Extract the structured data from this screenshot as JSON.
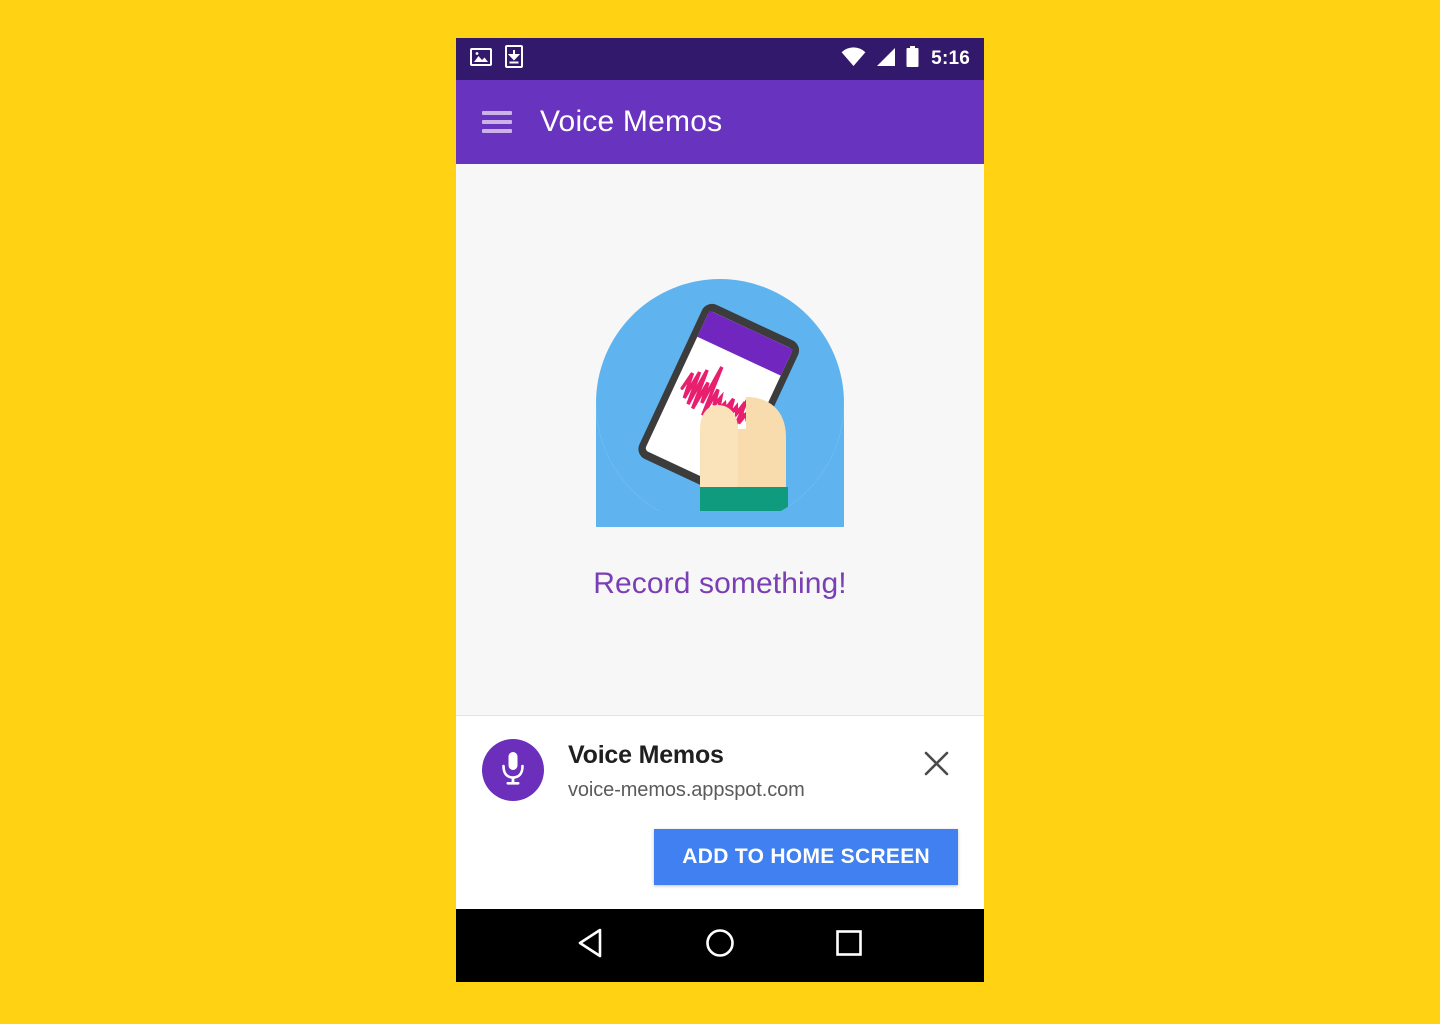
{
  "colors": {
    "page_background": "#FFD213",
    "status_bar": "#33196B",
    "app_bar": "#6833BE",
    "content_background": "#F7F7F7",
    "empty_text": "#7B3FB5",
    "cta_blue": "#4080F0",
    "badge_purple": "#6B2FBB",
    "illustration_circle": "#5FB4F0",
    "illustration_sleeve": "#0E9B7E",
    "illustration_skin": "#F8DCAE",
    "illustration_waveform": "#E81E6E",
    "nav_bar": "#000000"
  },
  "status_bar": {
    "left_icons": [
      "screenshot-icon",
      "download-icon"
    ],
    "right_icons": [
      "wifi-icon",
      "cellular-signal-icon",
      "battery-icon"
    ],
    "time": "5:16"
  },
  "app_bar": {
    "menu_icon": "hamburger-menu-icon",
    "title": "Voice Memos"
  },
  "content": {
    "illustration_name": "hand-holding-phone-recording-illustration",
    "empty_state_text": "Record something!"
  },
  "install_banner": {
    "app_icon": "microphone-icon",
    "app_name": "Voice Memos",
    "url": "voice-memos.appspot.com",
    "close_icon": "close-icon",
    "cta_label": "ADD TO HOME SCREEN"
  },
  "nav_bar": {
    "buttons": [
      {
        "name": "back-button",
        "icon": "triangle-back-icon"
      },
      {
        "name": "home-button",
        "icon": "circle-home-icon"
      },
      {
        "name": "recents-button",
        "icon": "square-recents-icon"
      }
    ]
  }
}
